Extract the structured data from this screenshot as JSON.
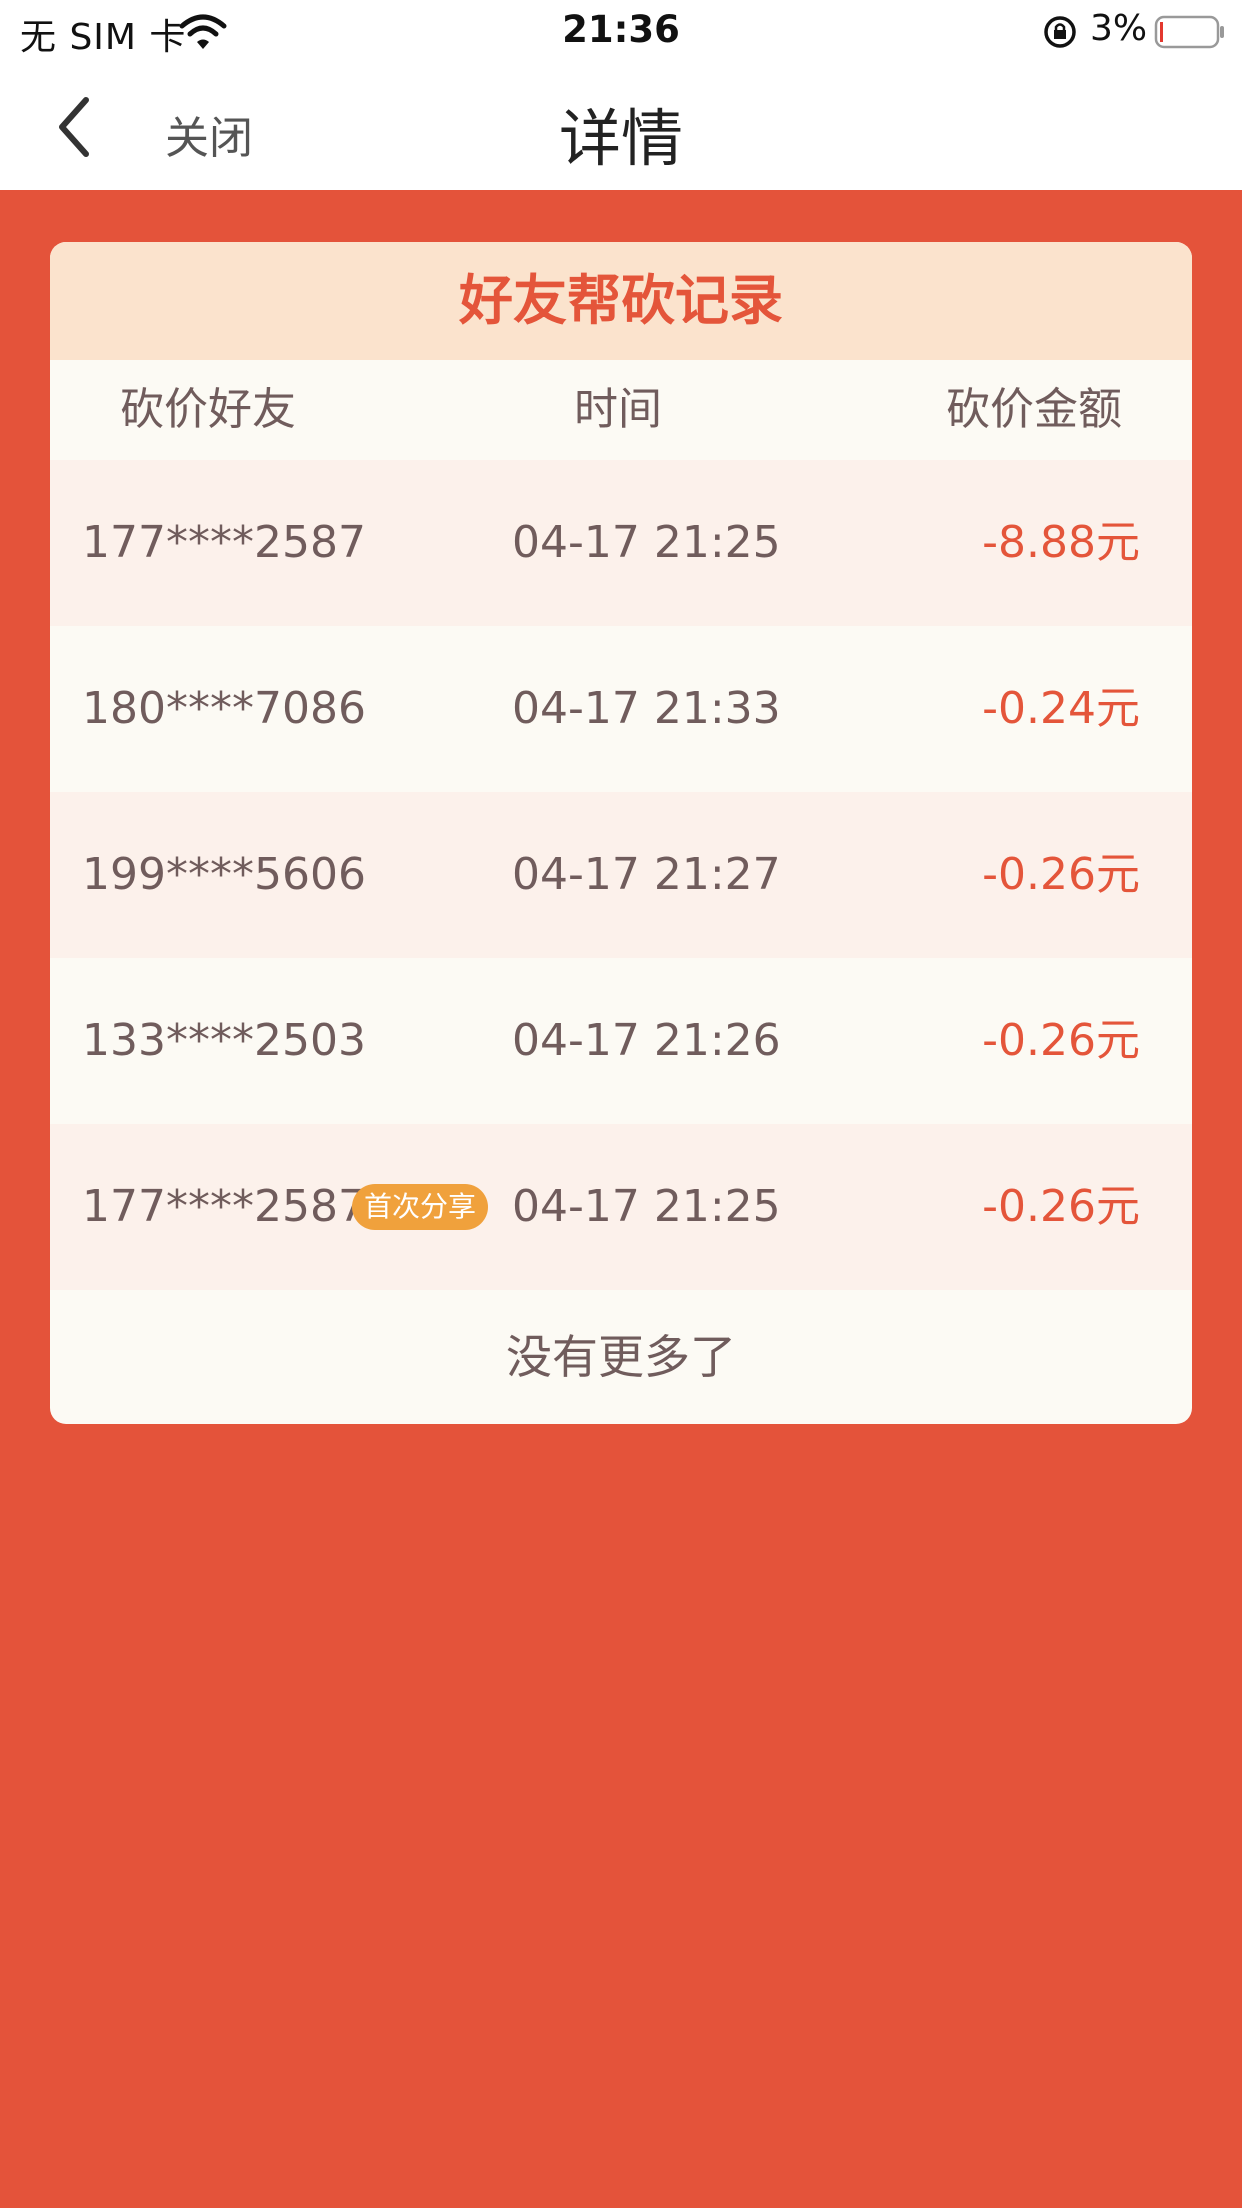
{
  "status_bar": {
    "carrier": "无 SIM 卡",
    "time": "21:36",
    "battery": "3%",
    "icons": [
      "wifi-icon",
      "orientation-lock-icon",
      "battery-icon"
    ]
  },
  "nav": {
    "back_icon": "chevron-left-icon",
    "close_label": "关闭",
    "title": "详情"
  },
  "card": {
    "title": "好友帮砍记录",
    "columns": {
      "friend": "砍价好友",
      "time": "时间",
      "amount": "砍价金额"
    },
    "rows": [
      {
        "friend": "177****2587",
        "time": "04-17 21:25",
        "amount": "-8.88元"
      },
      {
        "friend": "180****7086",
        "time": "04-17 21:33",
        "amount": "-0.24元"
      },
      {
        "friend": "199****5606",
        "time": "04-17 21:27",
        "amount": "-0.26元"
      },
      {
        "friend": "133****2503",
        "time": "04-17 21:26",
        "amount": "-0.26元"
      },
      {
        "friend": "177****2587",
        "badge": "首次分享",
        "time": "04-17 21:25",
        "amount": "-0.26元"
      }
    ],
    "footer": "没有更多了"
  },
  "colors": {
    "background": "#e4533a",
    "accent": "#e4553a",
    "header_bg": "#fbe3cd",
    "badge": "#f0a13c",
    "text": "#705c5c"
  }
}
